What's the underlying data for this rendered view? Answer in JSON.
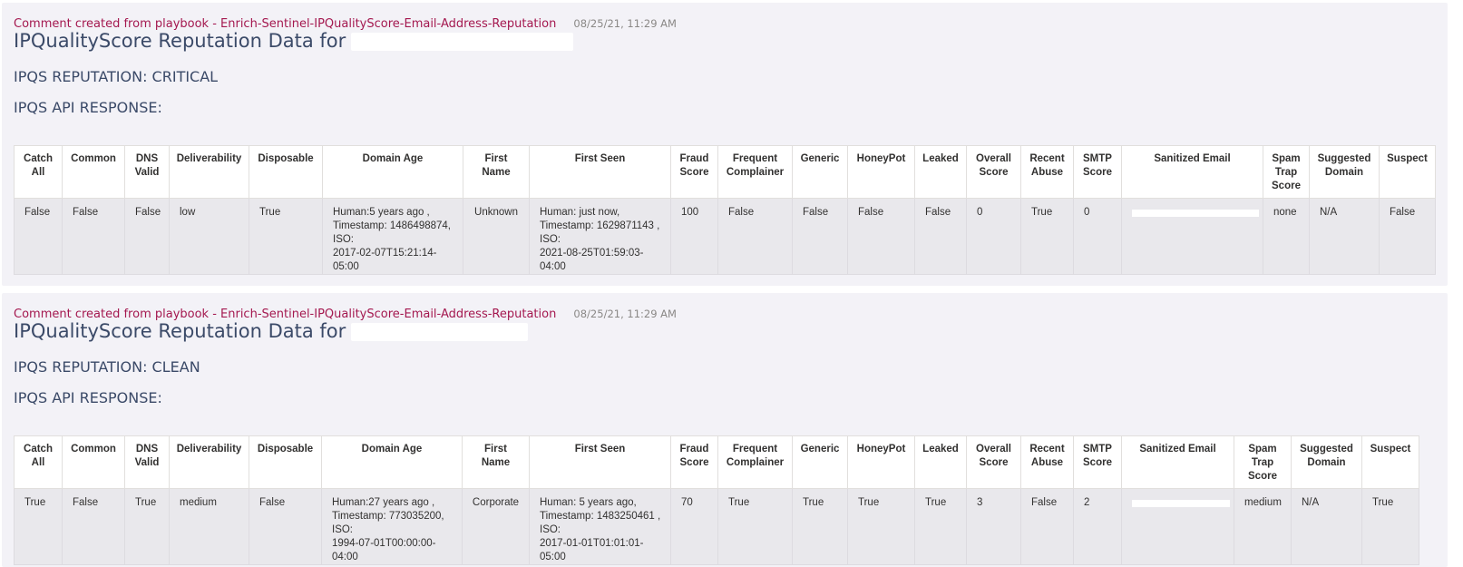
{
  "comments": [
    {
      "author": "Comment created from playbook - Enrich-Sentinel-IPQualityScore-Email-Address-Reputation",
      "timestamp": "08/25/21, 11:29 AM",
      "title": "IPQualityScore Reputation Data for",
      "reputation": "IPQS REPUTATION: CRITICAL",
      "api_label": "IPQS API RESPONSE:",
      "row": {
        "catch_all": "False",
        "common": "False",
        "dns_valid": "False",
        "deliverability": "low",
        "disposable": "True",
        "domain_age_1": "Human:5 years ago ,",
        "domain_age_2": "Timestamp: 1486498874,",
        "domain_age_3": "ISO:",
        "domain_age_4": "2017-02-07T15:21:14-05:00",
        "first_name": "Unknown",
        "first_seen_1": "Human: just now,",
        "first_seen_2": "Timestamp: 1629871143 ,",
        "first_seen_3": "ISO:",
        "first_seen_4": "2021-08-25T01:59:03-04:00",
        "fraud_score": "100",
        "frequent_complainer": "False",
        "generic": "False",
        "honeypot": "False",
        "leaked": "False",
        "overall_score": "0",
        "recent_abuse": "True",
        "smtp_score": "0",
        "spam_trap_score": "none",
        "suggested_domain": "N/A",
        "suspect": "False"
      }
    },
    {
      "author": "Comment created from playbook - Enrich-Sentinel-IPQualityScore-Email-Address-Reputation",
      "timestamp": "08/25/21, 11:29 AM",
      "title": "IPQualityScore Reputation Data for",
      "reputation": "IPQS REPUTATION: CLEAN",
      "api_label": "IPQS API RESPONSE:",
      "row": {
        "catch_all": "True",
        "common": "False",
        "dns_valid": "True",
        "deliverability": "medium",
        "disposable": "False",
        "domain_age_1": "Human:27 years ago ,",
        "domain_age_2": "Timestamp: 773035200,",
        "domain_age_3": "ISO:",
        "domain_age_4": "1994-07-01T00:00:00-04:00",
        "first_name": "Corporate",
        "first_seen_1": "Human: 5 years ago,",
        "first_seen_2": "Timestamp: 1483250461 ,",
        "first_seen_3": "ISO:",
        "first_seen_4": "2017-01-01T01:01:01-05:00",
        "fraud_score": "70",
        "frequent_complainer": "True",
        "generic": "True",
        "honeypot": "True",
        "leaked": "True",
        "overall_score": "3",
        "recent_abuse": "False",
        "smtp_score": "2",
        "spam_trap_score": "medium",
        "suggested_domain": "N/A",
        "suspect": "True"
      }
    }
  ],
  "headers": {
    "catch_all_1": "Catch",
    "catch_all_2": "All",
    "common": "Common",
    "dns_valid_1": "DNS",
    "dns_valid_2": "Valid",
    "deliverability": "Deliverability",
    "disposable": "Disposable",
    "domain_age": "Domain Age",
    "first_name_1": "First",
    "first_name_2": "Name",
    "first_seen": "First Seen",
    "fraud_score_1": "Fraud",
    "fraud_score_2": "Score",
    "frequent_complainer_1": "Frequent",
    "frequent_complainer_2": "Complainer",
    "generic": "Generic",
    "honeypot": "HoneyPot",
    "leaked": "Leaked",
    "overall_score_1": "Overall",
    "overall_score_2": "Score",
    "recent_abuse_1": "Recent",
    "recent_abuse_2": "Abuse",
    "smtp_score_1": "SMTP",
    "smtp_score_2": "Score",
    "sanitized_email": "Sanitized Email",
    "spam_trap_score_1": "Spam",
    "spam_trap_score_2": "Trap",
    "spam_trap_score_3": "Score",
    "suggested_domain_1": "Suggested",
    "suggested_domain_2": "Domain",
    "suspect": "Suspect"
  }
}
